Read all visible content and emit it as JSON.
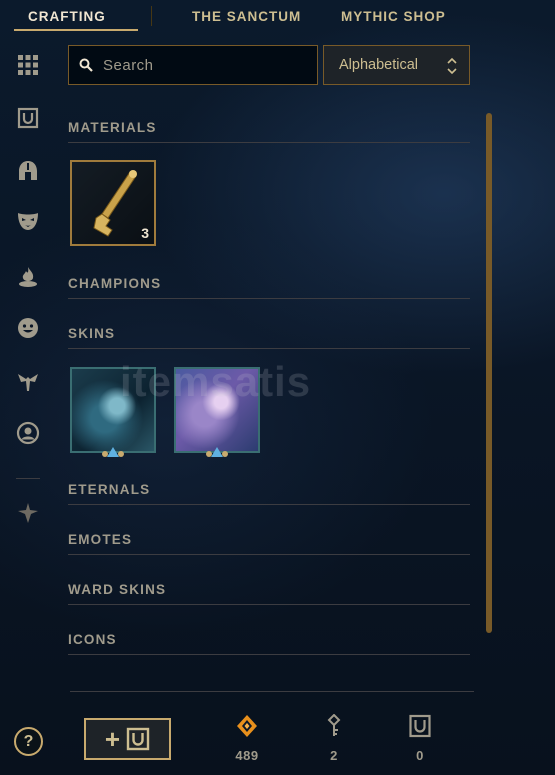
{
  "nav": {
    "tabs": [
      {
        "label": "CRAFTING",
        "active": true
      },
      {
        "label": "THE SANCTUM",
        "active": false
      },
      {
        "label": "MYTHIC SHOP",
        "active": false
      }
    ]
  },
  "sidebar": {
    "items": [
      {
        "icon": "grid-icon"
      },
      {
        "icon": "chest-icon"
      },
      {
        "icon": "helmet-icon"
      },
      {
        "icon": "mask-icon"
      },
      {
        "icon": "flame-icon"
      },
      {
        "icon": "emote-face-icon"
      },
      {
        "icon": "ward-icon"
      },
      {
        "icon": "profile-icon"
      },
      {
        "icon": "arrow-down-emblem-icon"
      }
    ]
  },
  "search": {
    "placeholder": "Search",
    "value": ""
  },
  "sort": {
    "selected": "Alphabetical"
  },
  "sections": [
    {
      "title": "MATERIALS"
    },
    {
      "title": "CHAMPIONS"
    },
    {
      "title": "SKINS"
    },
    {
      "title": "ETERNALS"
    },
    {
      "title": "EMOTES"
    },
    {
      "title": "WARD SKINS"
    },
    {
      "title": "ICONS"
    }
  ],
  "materials": [
    {
      "icon": "hextech-key-icon",
      "count": "3"
    }
  ],
  "skins": [
    {
      "icon": "skin-shard-1"
    },
    {
      "icon": "skin-shard-2"
    }
  ],
  "watermark": "itemsatis",
  "footer": {
    "help_label": "?",
    "add_label": "+",
    "currencies": [
      {
        "icon": "orange-essence-icon",
        "amount": "489"
      },
      {
        "icon": "key-icon",
        "amount": "2"
      },
      {
        "icon": "chest-icon",
        "amount": "0"
      }
    ]
  },
  "colors": {
    "gold": "#c8aa6e",
    "text": "#a09b8c",
    "background": "#0a1626",
    "orange_essence": "#f0a030"
  }
}
